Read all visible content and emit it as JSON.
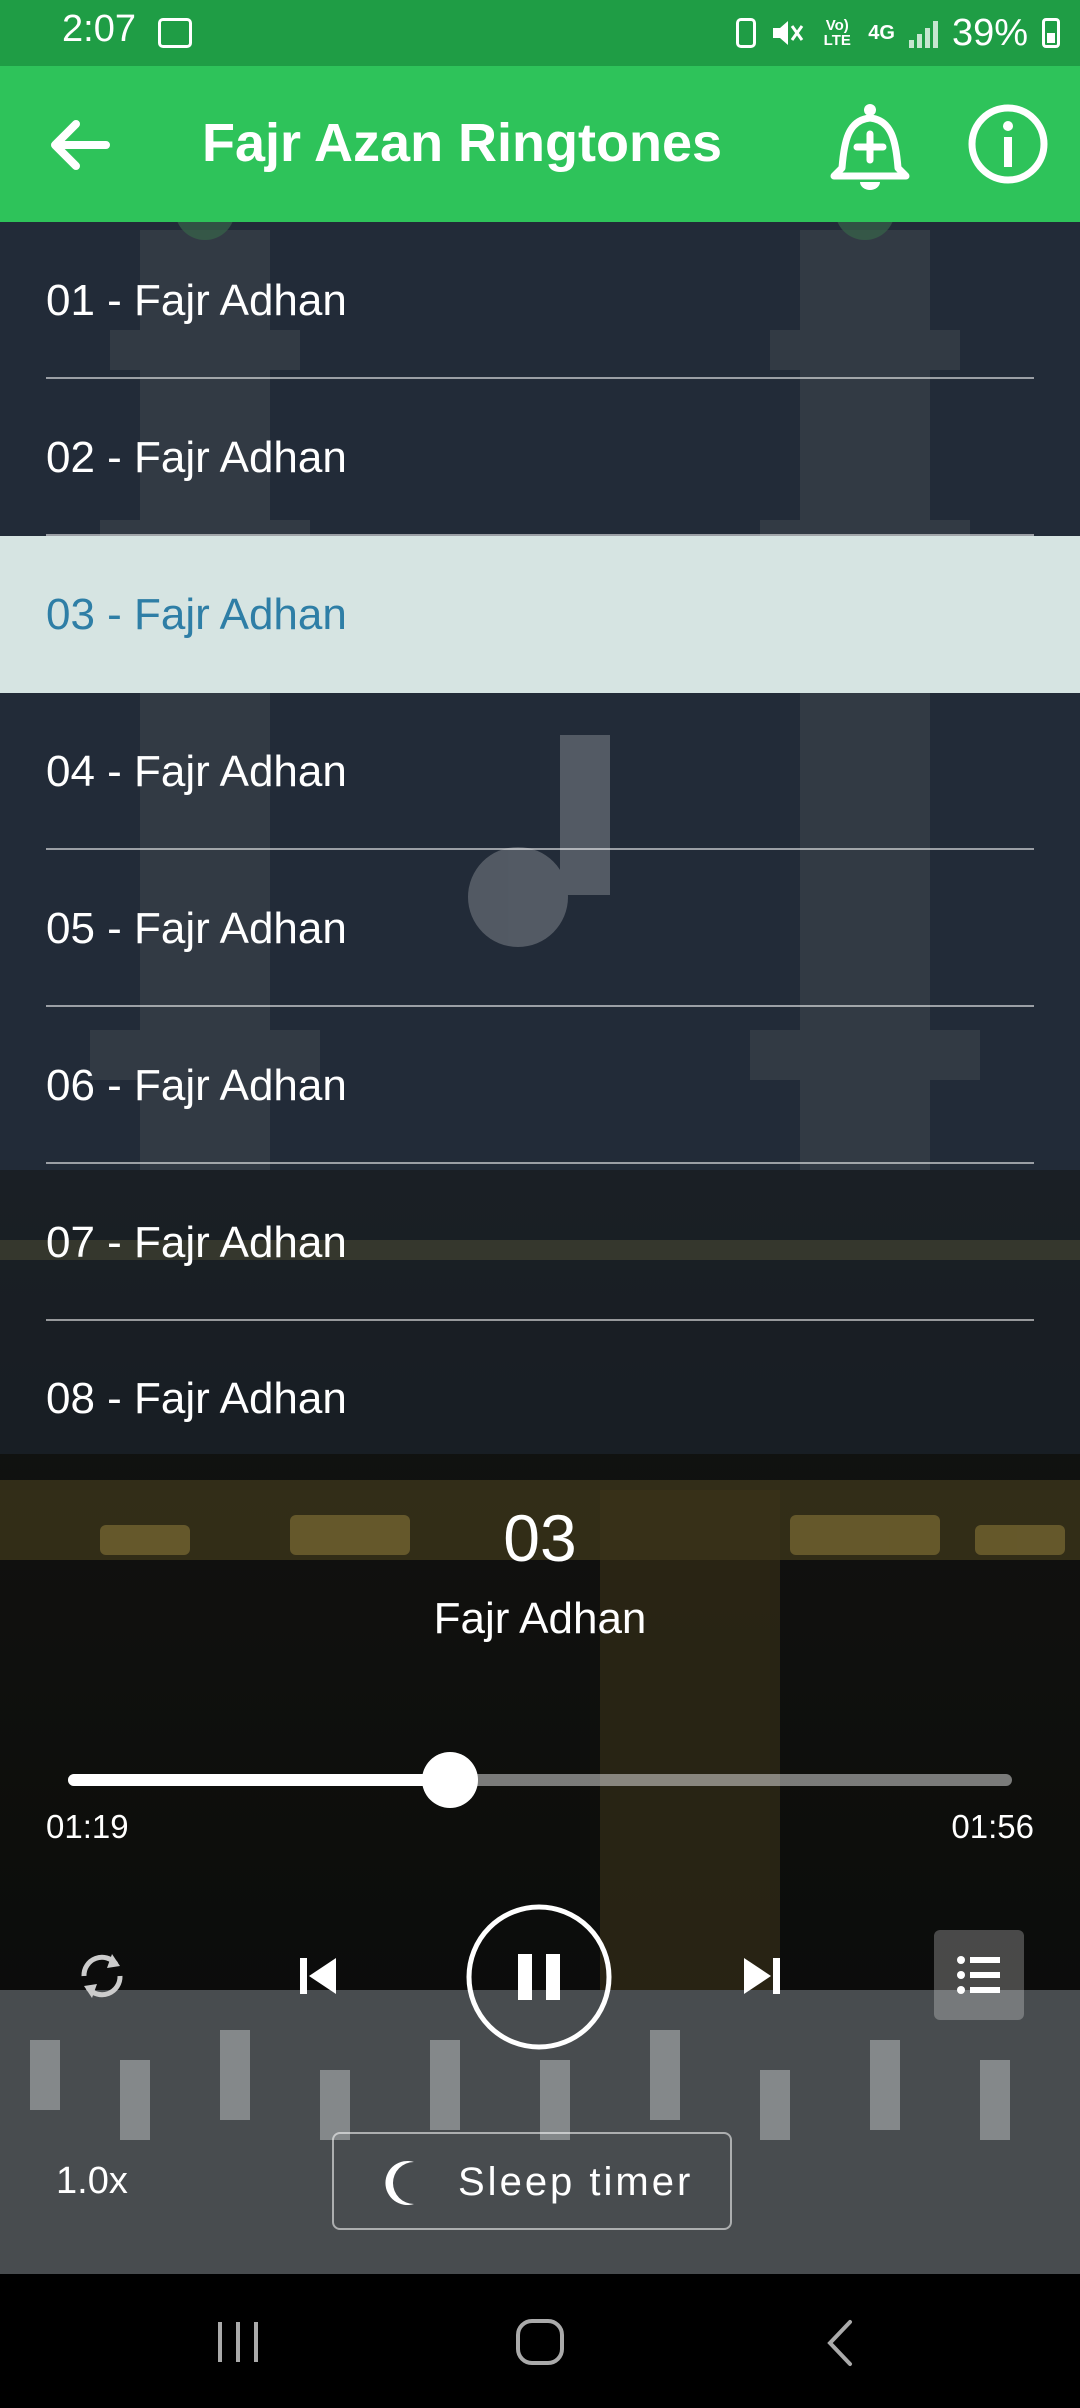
{
  "status_bar": {
    "time": "2:07",
    "net_volte": "Vo) LTE",
    "net_type": "4G",
    "battery_pct": "39%"
  },
  "app_bar": {
    "title": "Fajr Azan Ringtones",
    "back_icon": "arrow-left-icon",
    "alarm_icon": "alarm-add-icon",
    "info_icon": "info-icon"
  },
  "tracks": [
    {
      "label": "01 - Fajr Adhan"
    },
    {
      "label": "02 - Fajr Adhan"
    },
    {
      "label": "03 - Fajr Adhan"
    },
    {
      "label": "04 - Fajr Adhan"
    },
    {
      "label": "05 - Fajr Adhan"
    },
    {
      "label": "06 - Fajr Adhan"
    },
    {
      "label": "07 - Fajr Adhan"
    },
    {
      "label": "08 - Fajr Adhan"
    }
  ],
  "selected_track_index": 2,
  "player": {
    "track_number": "03",
    "track_name": "Fajr Adhan",
    "elapsed": "01:19",
    "duration": "01:56",
    "progress_fraction": 0.405,
    "speed": "1.0x",
    "sleep_timer_label": "Sleep timer"
  },
  "colors": {
    "status_bar": "#1f9d45",
    "app_bar": "#2ec35a",
    "selected_row_bg": "#d6e4e2",
    "selected_row_text": "#2e7ea6"
  }
}
